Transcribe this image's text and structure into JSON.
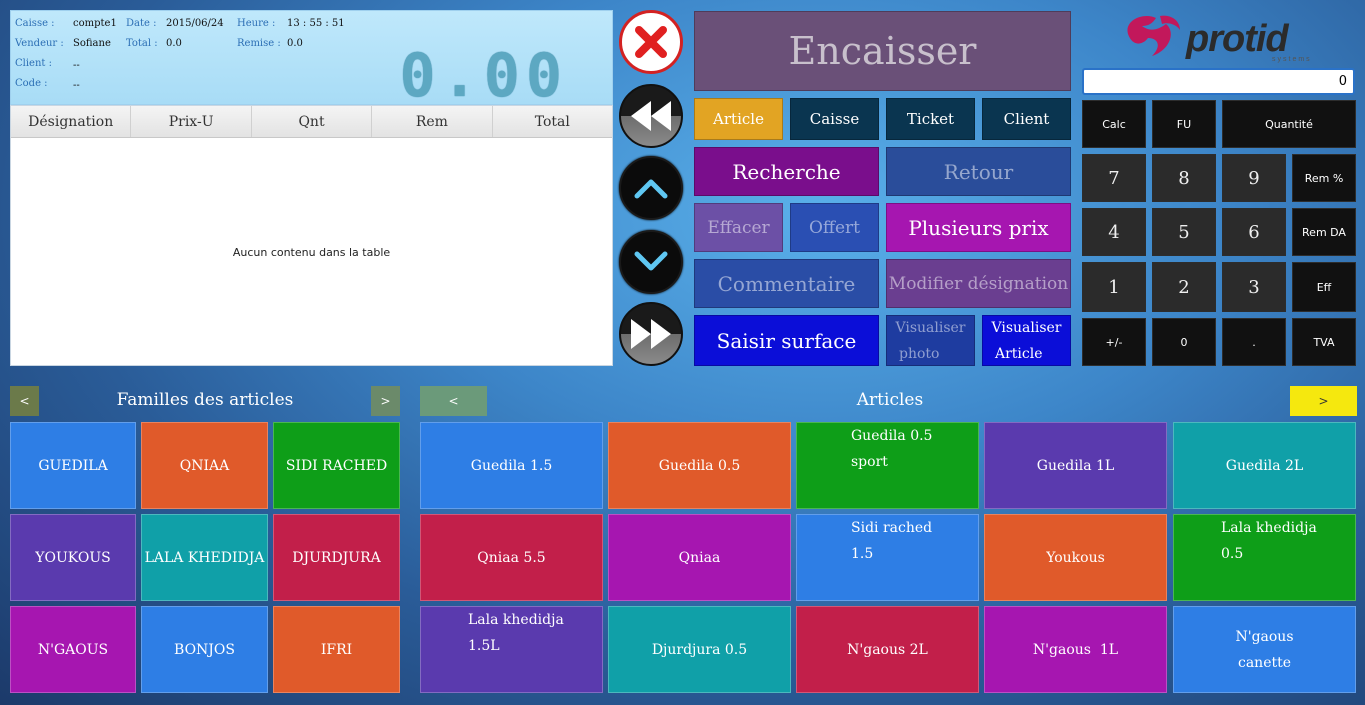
{
  "info": {
    "caisse_label": "Caisse :",
    "caisse_value": "compte1",
    "date_label": "Date :",
    "date_value": "2015/06/24",
    "heure_label": "Heure :",
    "heure_value": "13 : 55 : 51",
    "vendeur_label": "Vendeur :",
    "vendeur_value": "Sofiane",
    "total_label": "Total :",
    "total_value": "0.0",
    "remise_label": "Remise :",
    "remise_value": "0.0",
    "client_label": "Client :",
    "client_value": "--",
    "code_label": "Code :",
    "code_value": "--",
    "big_total": "0.00"
  },
  "table": {
    "headers": [
      "Désignation",
      "Prix-U",
      "Qnt",
      "Rem",
      "Total"
    ],
    "empty_text": "Aucun contenu dans la table"
  },
  "actions": {
    "encaisser": "Encaisser",
    "tabs": [
      "Article",
      "Caisse",
      "Ticket",
      "Client"
    ],
    "recherche": "Recherche",
    "retour": "Retour",
    "effacer": "Effacer",
    "offert": "Offert",
    "plusieurs_prix": "Plusieurs prix",
    "commentaire": "Commentaire",
    "modifier_designation": "Modifier désignation",
    "saisir_surface": "Saisir surface",
    "visualiser_photo_1": "Visualiser",
    "visualiser_photo_2": "photo",
    "visualiser_article_1": "Visualiser",
    "visualiser_article_2": "Article"
  },
  "logo": {
    "name": "protid",
    "sub": "systems"
  },
  "keypad": {
    "display": "0",
    "calc": "Calc",
    "fu": "FU",
    "quantite": "Quantité",
    "digits": [
      "7",
      "8",
      "9",
      "4",
      "5",
      "6",
      "1",
      "2",
      "3"
    ],
    "rem_pct": "Rem %",
    "rem_da": "Rem DA",
    "eff": "Eff",
    "plusminus": "+/-",
    "zero": "0",
    "dot": ".",
    "tva": "TVA"
  },
  "familles": {
    "title": "Familles des articles",
    "prev": "<",
    "next": ">",
    "items": [
      "GUEDILA",
      "QNIAA",
      "SIDI RACHED",
      "YOUKOUS",
      "LALA KHEDIDJA",
      "DJURDJURA",
      "N'GAOUS",
      "BONJOS",
      "IFRI"
    ]
  },
  "articles": {
    "title": "Articles",
    "prev": "<",
    "next": ">",
    "items": [
      [
        "Guedila 1.5"
      ],
      [
        "Guedila 0.5"
      ],
      [
        "Guedila 0.5",
        "sport"
      ],
      [
        "Guedila 1L"
      ],
      [
        "Guedila 2L"
      ],
      [
        "Qniaa 5.5"
      ],
      [
        "Qniaa"
      ],
      [
        "Sidi rached",
        "1.5"
      ],
      [
        "Youkous"
      ],
      [
        "Lala khedidja",
        "0.5"
      ],
      [
        "Lala khedidja",
        "1.5L"
      ],
      [
        "Djurdjura 0.5"
      ],
      [
        "N'gaous 2L"
      ],
      [
        "N'gaous  1L"
      ],
      [
        "N'gaous",
        "canette"
      ]
    ]
  },
  "colors": {
    "blue": "#2e7ee5",
    "orange": "#e05a2a",
    "green": "#0e9e18",
    "purple": "#5a3aae",
    "teal": "#10a0a8",
    "crimson": "#c21f4a",
    "magenta": "#a616b0",
    "gold": "#e2a423",
    "navy": "#0a3550",
    "violet": "#7a0e8c",
    "royal": "#0b0ed8",
    "yellow": "#f5e80e"
  }
}
